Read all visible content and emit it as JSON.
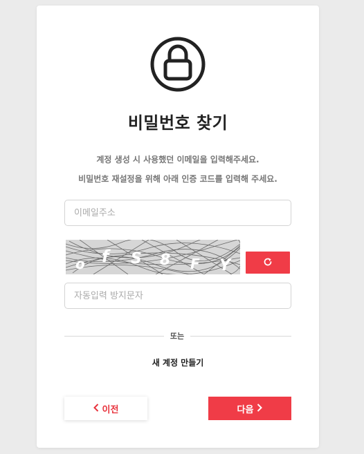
{
  "header": {
    "icon": "lock-icon",
    "title": "비밀번호 찾기",
    "description_line1": "계정 생성 시 사용했던 이메일을 입력해주세요.",
    "description_line2": "비밀번호 재설정을 위해 아래 인증 코드를 입력해 주세요."
  },
  "form": {
    "email_placeholder": "이메일주소",
    "email_value": "",
    "captcha_text": "ofS8FY",
    "captcha_refresh_icon": "refresh-icon",
    "captcha_input_placeholder": "자동입력 방지문자",
    "captcha_input_value": ""
  },
  "divider": {
    "label": "또는"
  },
  "links": {
    "create_account": "새 계정 만들기"
  },
  "buttons": {
    "prev_label": "이전",
    "prev_icon": "chevron-left-icon",
    "next_label": "다음",
    "next_icon": "chevron-right-icon"
  },
  "colors": {
    "accent": "#f03c47",
    "background": "#ebebeb",
    "card": "#ffffff",
    "title_text": "#222222",
    "muted_text": "#777777"
  }
}
